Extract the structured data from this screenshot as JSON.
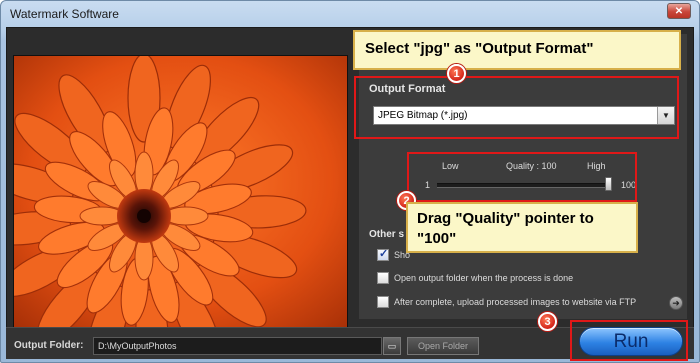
{
  "window": {
    "title": "Watermark Software",
    "close_glyph": "✕"
  },
  "callouts": {
    "step1": {
      "text": "Select \"jpg\" as \"Output Format\"",
      "badge": "1"
    },
    "step2": {
      "text": "Drag \"Quality\" pointer to \"100\"",
      "badge": "2"
    },
    "step3": {
      "badge": "3"
    }
  },
  "output_format": {
    "group_label": "Output Format",
    "selected": "JPEG Bitmap (*.jpg)",
    "dropdown_icon": "chevron-down-icon"
  },
  "quality": {
    "low_label": "Low",
    "high_label": "High",
    "caption": "Quality : 100",
    "min_label": "1",
    "max_label": "100",
    "value": 100,
    "min": 1,
    "max": 100
  },
  "other_settings": {
    "group_label_partial": "Other s",
    "options": [
      {
        "label": "Sho",
        "checked": true
      },
      {
        "label": "Open output folder when the process is done",
        "checked": false
      },
      {
        "label": "After complete, upload processed images to website via FTP",
        "checked": false
      }
    ],
    "info_icon": "arrow-circle-icon"
  },
  "bottom": {
    "output_folder_label": "Output Folder:",
    "output_folder_value": "D:\\MyOutputPhotos",
    "browse_icon": "folder-icon",
    "open_folder_label": "Open Folder",
    "run_label": "Run"
  },
  "colors": {
    "accent_red": "#e01818",
    "callout_fill": "#fbf7c8",
    "run_blue": "#2d82e4"
  }
}
